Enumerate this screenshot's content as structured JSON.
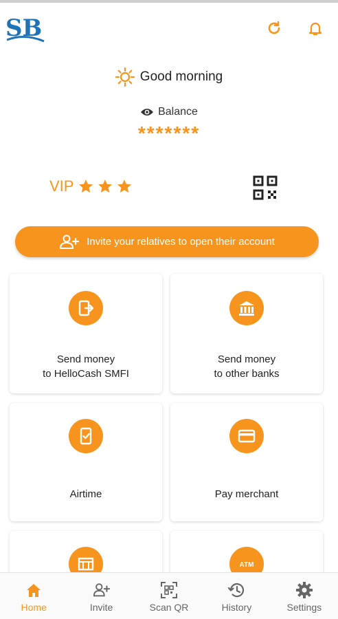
{
  "header": {
    "logo_text": "SB",
    "refresh_icon": "refresh-icon",
    "notification_icon": "bell-icon"
  },
  "greeting": {
    "icon": "sun-icon",
    "text": "Good morning"
  },
  "balance": {
    "icon": "eye-icon",
    "label": "Balance",
    "masked_value": "*******"
  },
  "status": {
    "vip_label": "VIP",
    "stars": 3,
    "qr_icon": "qr-code-icon"
  },
  "invite_banner": {
    "icon": "add-user-icon",
    "text": "Invite your relatives to open their account"
  },
  "services": [
    {
      "line1": "Send money",
      "line2": "to HelloCash SMFI",
      "icon": "phone-transfer-icon"
    },
    {
      "line1": "Send money",
      "line2": "to other banks",
      "icon": "bank-icon"
    },
    {
      "line1": "Airtime",
      "line2": "",
      "icon": "mobile-check-icon"
    },
    {
      "line1": "Pay merchant",
      "line2": "",
      "icon": "card-icon"
    },
    {
      "line1": "",
      "line2": "",
      "icon": "store-icon"
    },
    {
      "line1": "",
      "line2": "",
      "icon": "atm-icon"
    }
  ],
  "atm_badge": "ATM",
  "bottom_nav": [
    {
      "label": "Home",
      "icon": "home-icon",
      "active": true
    },
    {
      "label": "Invite",
      "icon": "add-user-icon",
      "active": false
    },
    {
      "label": "Scan QR",
      "icon": "scan-qr-icon",
      "active": false
    },
    {
      "label": "History",
      "icon": "history-icon",
      "active": false
    },
    {
      "label": "Settings",
      "icon": "gear-icon",
      "active": false
    }
  ],
  "colors": {
    "accent": "#f7941d",
    "logo_blue": "#1e73b8",
    "inactive_nav": "#666666"
  }
}
